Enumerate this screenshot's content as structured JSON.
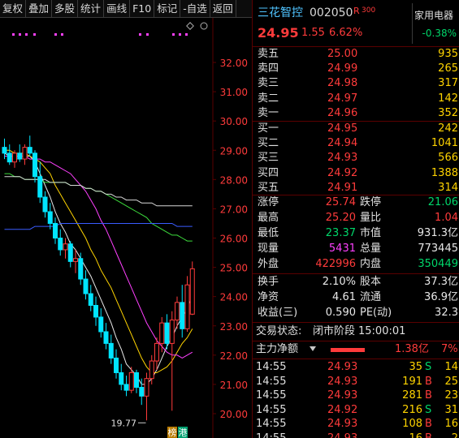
{
  "toolbar": [
    "复权",
    "叠加",
    "多股",
    "统计",
    "画线",
    "F10",
    "标记",
    "-自选",
    "返回"
  ],
  "stock": {
    "name": "三花智控",
    "code": "002050",
    "badge": "R",
    "badge_num": "300",
    "price": "24.95",
    "change": "1.55",
    "change_pct": "6.62%",
    "sector": "家用电器",
    "sector_pct": "-0.38%"
  },
  "sells": [
    {
      "label": "卖五",
      "price": "25.00",
      "vol": "935"
    },
    {
      "label": "卖四",
      "price": "24.99",
      "vol": "265"
    },
    {
      "label": "卖三",
      "price": "24.98",
      "vol": "317"
    },
    {
      "label": "卖二",
      "price": "24.97",
      "vol": "142"
    },
    {
      "label": "卖一",
      "price": "24.96",
      "vol": "352"
    }
  ],
  "buys": [
    {
      "label": "买一",
      "price": "24.95",
      "vol": "242"
    },
    {
      "label": "买二",
      "price": "24.94",
      "vol": "1041"
    },
    {
      "label": "买三",
      "price": "24.93",
      "vol": "566"
    },
    {
      "label": "买四",
      "price": "24.92",
      "vol": "1388"
    },
    {
      "label": "买五",
      "price": "24.91",
      "vol": "314"
    }
  ],
  "stats": [
    {
      "l1": "涨停",
      "v1": "25.74",
      "c1": "red",
      "l2": "跌停",
      "v2": "21.06",
      "c2": "green"
    },
    {
      "l1": "最高",
      "v1": "25.20",
      "c1": "red",
      "l2": "量比",
      "v2": "1.04",
      "c2": "red"
    },
    {
      "l1": "最低",
      "v1": "23.37",
      "c1": "green",
      "l2": "市值",
      "v2": "931.3亿",
      "c2": "white"
    },
    {
      "l1": "现量",
      "v1": "5431",
      "c1": "magenta",
      "l2": "总量",
      "v2": "773445",
      "c2": "white"
    },
    {
      "l1": "外盘",
      "v1": "422996",
      "c1": "red",
      "l2": "内盘",
      "v2": "350449",
      "c2": "green"
    }
  ],
  "stats2": [
    {
      "l1": "换手",
      "v1": "2.10%",
      "l2": "股本",
      "v2": "37.3亿"
    },
    {
      "l1": "净资",
      "v1": "4.61",
      "l2": "流通",
      "v2": "36.9亿"
    },
    {
      "l1": "收益(三)",
      "v1": "0.590",
      "l2": "PE(动)",
      "v2": "32.3"
    }
  ],
  "trade_status": {
    "label": "交易状态:",
    "value": "闭市阶段",
    "time": "15:00:01"
  },
  "net_flow": {
    "label": "主力净额",
    "value": "1.38亿",
    "pct": "7%"
  },
  "ticks": [
    {
      "time": "14:55",
      "price": "24.93",
      "vol": "35",
      "side": "S",
      "n": "14"
    },
    {
      "time": "14:55",
      "price": "24.93",
      "vol": "191",
      "side": "B",
      "n": "25"
    },
    {
      "time": "14:55",
      "price": "24.93",
      "vol": "281",
      "side": "B",
      "n": "23"
    },
    {
      "time": "14:55",
      "price": "24.92",
      "vol": "216",
      "side": "S",
      "n": "31"
    },
    {
      "time": "14:55",
      "price": "24.93",
      "vol": "108",
      "side": "B",
      "n": "16"
    },
    {
      "time": "14:55",
      "price": "24.93",
      "vol": "16",
      "side": "B",
      "n": "2"
    }
  ],
  "colors": {
    "up": "#ff3b3b",
    "down": "#00d66a",
    "bg": "#000000",
    "grid": "#5a0000"
  },
  "chart_data": {
    "type": "candlestick",
    "y_ticks": [
      "32.00",
      "31.00",
      "30.00",
      "29.00",
      "28.00",
      "27.00",
      "26.00",
      "25.00",
      "24.00",
      "23.00",
      "22.00",
      "21.00",
      "20.00"
    ],
    "ylim": [
      19.7,
      33.0
    ],
    "low_label": "19.77",
    "tags": [
      "榜",
      "港"
    ],
    "candles": [
      [
        29.1,
        29.4,
        28.7,
        28.9
      ],
      [
        28.9,
        29.2,
        28.5,
        28.6
      ],
      [
        28.6,
        29.0,
        28.4,
        28.9
      ],
      [
        28.9,
        29.2,
        28.6,
        28.7
      ],
      [
        28.7,
        29.2,
        28.5,
        29.1
      ],
      [
        29.1,
        29.5,
        28.8,
        28.9
      ],
      [
        28.9,
        29.0,
        27.9,
        28.1
      ],
      [
        28.1,
        28.6,
        27.2,
        27.4
      ],
      [
        27.4,
        27.6,
        26.7,
        26.9
      ],
      [
        26.9,
        27.2,
        26.3,
        26.5
      ],
      [
        26.5,
        26.7,
        25.8,
        26.0
      ],
      [
        26.0,
        26.3,
        25.4,
        25.6
      ],
      [
        25.6,
        26.0,
        25.3,
        25.8
      ],
      [
        25.8,
        25.9,
        25.0,
        25.2
      ],
      [
        25.2,
        25.6,
        24.8,
        25.3
      ],
      [
        25.3,
        25.5,
        24.4,
        24.6
      ],
      [
        24.6,
        24.9,
        23.9,
        24.1
      ],
      [
        24.1,
        24.4,
        23.5,
        23.7
      ],
      [
        23.7,
        24.0,
        23.0,
        23.3
      ],
      [
        23.3,
        23.6,
        22.6,
        22.8
      ],
      [
        22.8,
        23.1,
        22.2,
        22.4
      ],
      [
        22.4,
        22.7,
        21.7,
        21.9
      ],
      [
        21.9,
        22.2,
        21.2,
        21.4
      ],
      [
        21.4,
        21.7,
        20.8,
        21.0
      ],
      [
        21.0,
        21.3,
        20.6,
        20.8
      ],
      [
        20.8,
        21.6,
        20.7,
        21.4
      ],
      [
        21.4,
        21.5,
        20.7,
        20.9
      ],
      [
        20.9,
        21.2,
        20.3,
        20.6
      ],
      [
        20.6,
        21.4,
        19.77,
        21.2
      ],
      [
        21.2,
        22.0,
        21.0,
        21.8
      ],
      [
        21.8,
        22.6,
        21.5,
        22.4
      ],
      [
        22.4,
        23.3,
        22.1,
        23.1
      ],
      [
        23.1,
        23.4,
        22.2,
        22.4
      ],
      [
        22.4,
        23.5,
        20.1,
        23.2
      ],
      [
        23.2,
        24.0,
        22.9,
        23.8
      ],
      [
        23.8,
        24.4,
        22.6,
        22.9
      ],
      [
        22.9,
        24.7,
        22.8,
        24.4
      ],
      [
        23.4,
        25.2,
        23.37,
        24.95
      ]
    ],
    "ma": [
      {
        "name": "MA5",
        "color": "#e8e8e8",
        "values": [
          28.9,
          28.8,
          28.8,
          28.8,
          28.8,
          28.8,
          28.6,
          28.2,
          27.8,
          27.4,
          26.9,
          26.5,
          26.2,
          25.8,
          25.6,
          25.3,
          25.0,
          24.7,
          24.3,
          23.9,
          23.5,
          23.1,
          22.6,
          22.2,
          21.7,
          21.5,
          21.3,
          21.0,
          21.0,
          21.2,
          21.5,
          21.9,
          22.3,
          22.6,
          23.0,
          23.3,
          23.6,
          24.0
        ]
      },
      {
        "name": "MA10",
        "color": "#ffd400",
        "values": [
          29.0,
          29.0,
          28.9,
          28.9,
          28.9,
          28.8,
          28.7,
          28.6,
          28.4,
          28.2,
          27.8,
          27.5,
          27.2,
          26.9,
          26.6,
          26.3,
          26.0,
          25.6,
          25.3,
          24.9,
          24.6,
          24.3,
          23.9,
          23.5,
          23.1,
          22.7,
          22.3,
          21.9,
          21.6,
          21.4,
          21.4,
          21.5,
          21.6,
          21.8,
          22.1,
          22.4,
          22.6,
          22.9
        ]
      },
      {
        "name": "MA20",
        "color": "#ff40ff",
        "values": [
          28.8,
          28.8,
          28.8,
          28.8,
          28.8,
          28.7,
          28.7,
          28.7,
          28.6,
          28.6,
          28.5,
          28.4,
          28.3,
          28.2,
          28.0,
          27.8,
          27.6,
          27.3,
          27.0,
          26.6,
          26.3,
          25.9,
          25.5,
          25.1,
          24.7,
          24.3,
          23.9,
          23.5,
          23.1,
          22.8,
          22.5,
          22.3,
          22.1,
          22.0,
          22.0,
          21.9,
          22.0,
          22.1
        ]
      },
      {
        "name": "MA30",
        "color": "#3ddc3d",
        "values": [
          28.2,
          28.2,
          28.1,
          28.1,
          28.0,
          28.0,
          28.0,
          28.0,
          27.9,
          27.9,
          27.9,
          27.9,
          27.9,
          27.8,
          27.8,
          27.8,
          27.7,
          27.7,
          27.6,
          27.6,
          27.5,
          27.4,
          27.3,
          27.2,
          27.1,
          27.0,
          26.9,
          26.8,
          26.7,
          26.5,
          26.4,
          26.3,
          26.2,
          26.1,
          26.1,
          26.0,
          25.9,
          25.9
        ]
      },
      {
        "name": "MA60",
        "color": "#d8d8d8",
        "values": [
          28.1,
          28.1,
          28.1,
          28.1,
          28.0,
          28.0,
          28.0,
          28.0,
          28.0,
          27.9,
          27.9,
          27.9,
          27.9,
          27.8,
          27.8,
          27.8,
          27.7,
          27.7,
          27.6,
          27.6,
          27.5,
          27.5,
          27.4,
          27.4,
          27.3,
          27.3,
          27.3,
          27.2,
          27.2,
          27.2,
          27.1,
          27.1,
          27.1,
          27.1,
          27.1,
          27.1,
          27.1,
          27.1
        ]
      },
      {
        "name": "MA120",
        "color": "#3a5cff",
        "values": [
          26.3,
          26.3,
          26.3,
          26.3,
          26.3,
          26.3,
          26.4,
          26.4,
          26.4,
          26.4,
          26.4,
          26.5,
          26.5,
          26.5,
          26.5,
          26.5,
          26.5,
          26.5,
          26.5,
          26.5,
          26.5,
          26.5,
          26.5,
          26.5,
          26.5,
          26.5,
          26.5,
          26.5,
          26.5,
          26.5,
          26.5,
          26.5,
          26.5,
          26.5,
          26.4,
          26.4,
          26.4,
          26.4
        ]
      }
    ]
  }
}
